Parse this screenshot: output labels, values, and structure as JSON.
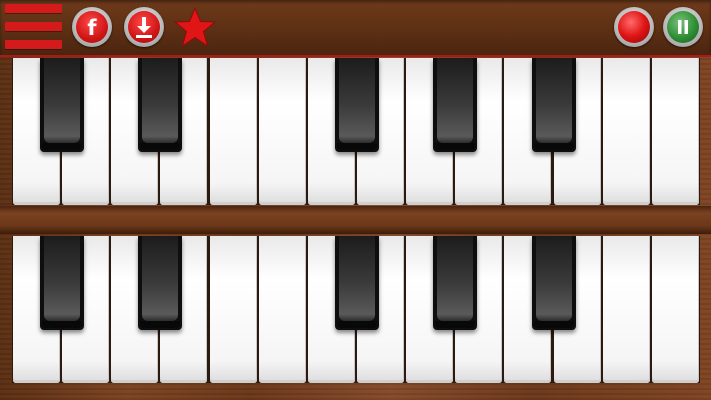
{
  "toolbar": {
    "menu_icon": "hamburger-menu-icon",
    "facebook_icon": "facebook-icon",
    "facebook_glyph": "f",
    "download_icon": "download-icon",
    "favorite_icon": "star-icon",
    "record_icon": "record-icon",
    "pause_icon": "pause-icon"
  },
  "colors": {
    "accent_red": "#d41a1a",
    "pause_green": "#2f8f35",
    "wood": "#6e3a1b"
  },
  "keyboards": [
    {
      "name": "upper",
      "white_keys": 14,
      "black_key_after_white": [
        1,
        3,
        7,
        9,
        11
      ]
    },
    {
      "name": "lower",
      "white_keys": 14,
      "black_key_after_white": [
        1,
        3,
        7,
        9,
        11
      ]
    }
  ]
}
